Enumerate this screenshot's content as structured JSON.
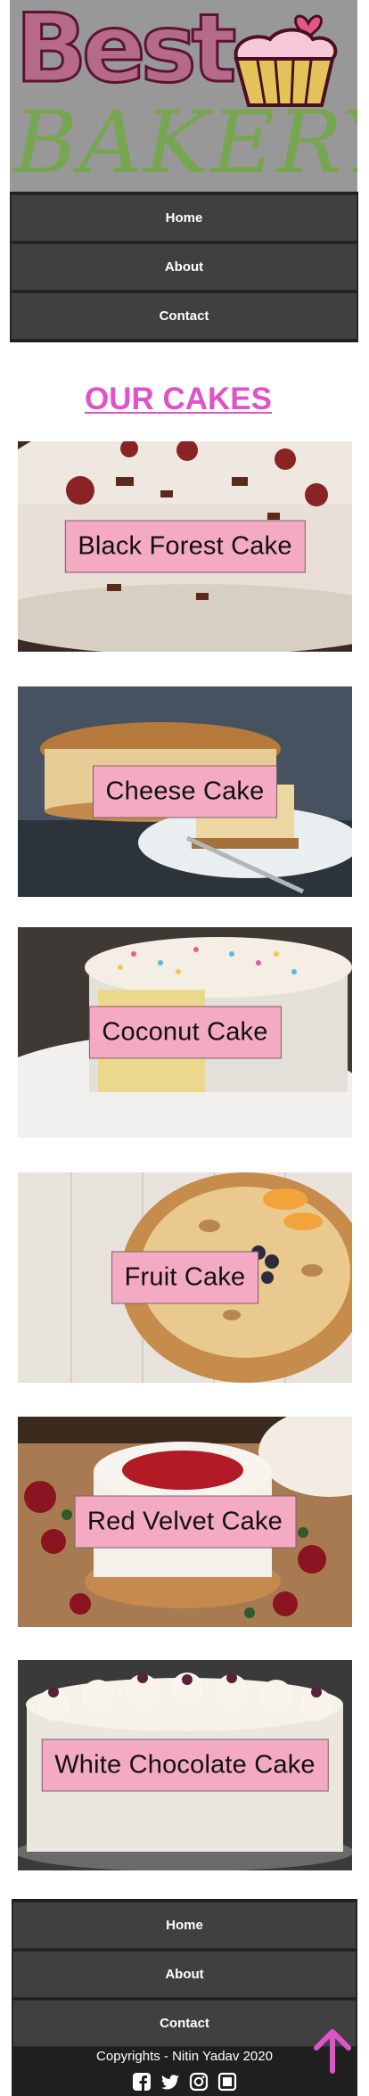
{
  "logo": {
    "line1": "Best",
    "line2": "BAKERY"
  },
  "nav": {
    "items": [
      {
        "label": "Home"
      },
      {
        "label": "About"
      },
      {
        "label": "Contact"
      }
    ]
  },
  "section_title": "OUR CAKES",
  "cakes": [
    {
      "name": "Black Forest Cake"
    },
    {
      "name": "Cheese Cake"
    },
    {
      "name": "Coconut Cake"
    },
    {
      "name": "Fruit Cake"
    },
    {
      "name": "Red Velvet Cake"
    },
    {
      "name": "White Chocolate Cake"
    }
  ],
  "footer": {
    "nav": [
      {
        "label": "Home"
      },
      {
        "label": "About"
      },
      {
        "label": "Contact"
      }
    ],
    "copyright": "Copyrights - Nitin Yadav 2020",
    "social_icons": [
      "facebook-icon",
      "twitter-icon",
      "instagram-icon",
      "linkedin-icon"
    ]
  },
  "colors": {
    "title_accent": "#e052c7",
    "label_bg": "#f4aac2",
    "nav_bg": "#404040",
    "logo_bg": "#989898",
    "scroll_top_arrow": "#e052c7"
  }
}
